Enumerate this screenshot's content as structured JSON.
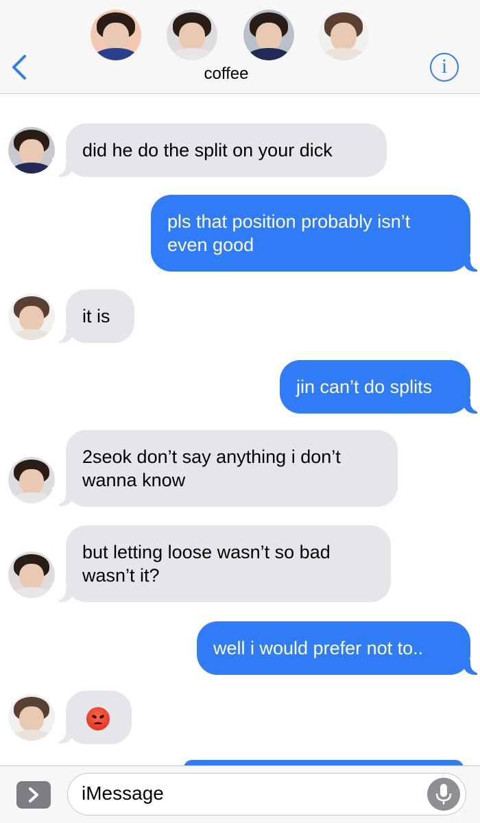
{
  "header": {
    "group_name": "coffee",
    "back_icon": "chevron-left-icon",
    "info_icon": "info-icon",
    "info_glyph": "i",
    "participants": [
      {
        "name": "participant-1",
        "shirt": "#2c3f8e",
        "bg": "#f3c9b6"
      },
      {
        "name": "participant-2",
        "shirt": "#e9e6e8",
        "bg": "#dedcdf"
      },
      {
        "name": "participant-3",
        "shirt": "#222a55",
        "bg": "#b8c0cc"
      },
      {
        "name": "participant-4",
        "shirt": "#e9e3dc",
        "bg": "#f0f0ee"
      }
    ]
  },
  "messages": [
    {
      "dir": "in",
      "text": "did he do the split on your dick",
      "avatar": "jin"
    },
    {
      "dir": "out",
      "text": "pls that position probably isn’t even good"
    },
    {
      "dir": "in",
      "text": "it is",
      "avatar": "hoseok"
    },
    {
      "dir": "out",
      "text": "jin can’t do splits"
    },
    {
      "dir": "in",
      "text": "2seok don’t say anything i don’t wanna know",
      "avatar": "jimin"
    },
    {
      "dir": "in",
      "text": "but letting loose wasn’t so bad wasn’t it?",
      "avatar": "jimin"
    },
    {
      "dir": "out",
      "text": "well i would prefer not to.."
    },
    {
      "dir": "in",
      "emoji": "angry-face-icon",
      "avatar": "hoseok"
    }
  ],
  "composer": {
    "placeholder": "iMessage",
    "apps_icon": "chevron-right-icon",
    "mic_icon": "microphone-icon"
  },
  "colors": {
    "accent": "#2f7cf6",
    "incoming_bubble": "#e5e5ea",
    "outgoing_bubble": "#2f7cf6"
  }
}
